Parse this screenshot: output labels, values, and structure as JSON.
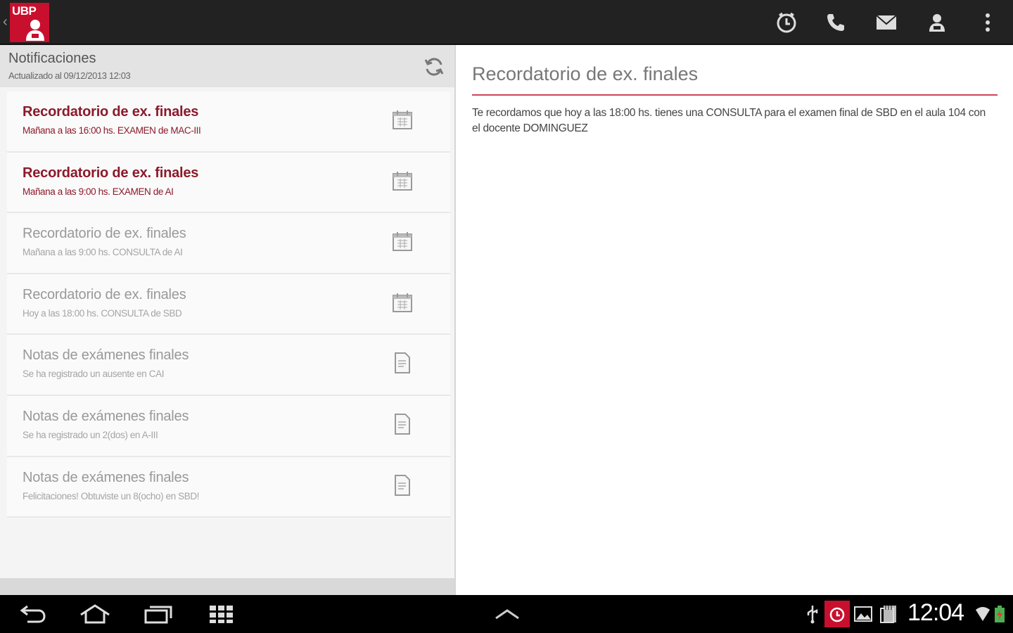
{
  "app": {
    "logo_text": "UBP",
    "actions": [
      {
        "name": "alarm-icon"
      },
      {
        "name": "phone-icon"
      },
      {
        "name": "mail-icon"
      },
      {
        "name": "contact-icon"
      },
      {
        "name": "overflow-menu-icon"
      }
    ]
  },
  "notifications": {
    "title": "Notificaciones",
    "updated": "Actualizado al 09/12/2013 12:03",
    "items": [
      {
        "title": "Recordatorio de ex. finales",
        "subtitle": "Mañana a las 16:00 hs. EXAMEN de MAC-III",
        "icon": "calendar-icon",
        "state": "unread"
      },
      {
        "title": "Recordatorio de ex. finales",
        "subtitle": "Mañana a las 9:00 hs. EXAMEN de AI",
        "icon": "calendar-icon",
        "state": "unread"
      },
      {
        "title": "Recordatorio de ex. finales",
        "subtitle": "Mañana a las 9:00 hs. CONSULTA de AI",
        "icon": "calendar-icon",
        "state": "read"
      },
      {
        "title": "Recordatorio de ex. finales",
        "subtitle": "Hoy a las 18:00 hs. CONSULTA de SBD",
        "icon": "calendar-icon",
        "state": "read"
      },
      {
        "title": "Notas de exámenes finales",
        "subtitle": "Se ha registrado un ausente en CAI",
        "icon": "document-icon",
        "state": "read"
      },
      {
        "title": "Notas de exámenes finales",
        "subtitle": "Se ha registrado un 2(dos) en A-III",
        "icon": "document-icon",
        "state": "read"
      },
      {
        "title": "Notas de exámenes finales",
        "subtitle": "Felicitaciones! Obtuviste un 8(ocho) en SBD!",
        "icon": "document-icon",
        "state": "read"
      }
    ]
  },
  "detail": {
    "title": "Recordatorio de ex. finales",
    "body": "Te recordamos que hoy a las 18:00 hs. tienes una CONSULTA para el examen final de SBD en el aula 104 con el docente DOMINGUEZ"
  },
  "system": {
    "clock": "12:04"
  },
  "colors": {
    "accent": "#c8102e",
    "unread_text": "#8b1a2b",
    "rule": "#d0435a",
    "actionbar": "#222222"
  }
}
